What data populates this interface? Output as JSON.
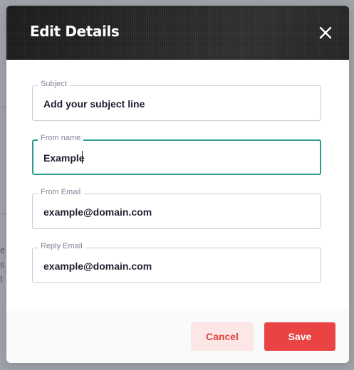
{
  "modal": {
    "title": "Edit Details",
    "close_icon": "close-icon"
  },
  "fields": [
    {
      "label": "Subject",
      "value": "Add your subject line",
      "focused": false
    },
    {
      "label": "From name",
      "value": "Example",
      "focused": true
    },
    {
      "label": "From Email",
      "value": "example@domain.com",
      "focused": false
    },
    {
      "label": "Reply Email",
      "value": "example@domain.com",
      "focused": false
    }
  ],
  "footer": {
    "cancel_label": "Cancel",
    "save_label": "Save"
  },
  "background": {
    "fragments": [
      "e",
      "s",
      "t"
    ]
  },
  "colors": {
    "focus_border": "#2f9a91",
    "save_button": "#e94443",
    "cancel_button_bg": "#fde6e6",
    "cancel_button_text": "#e0443f",
    "header_bg": "#1d1d1d"
  }
}
